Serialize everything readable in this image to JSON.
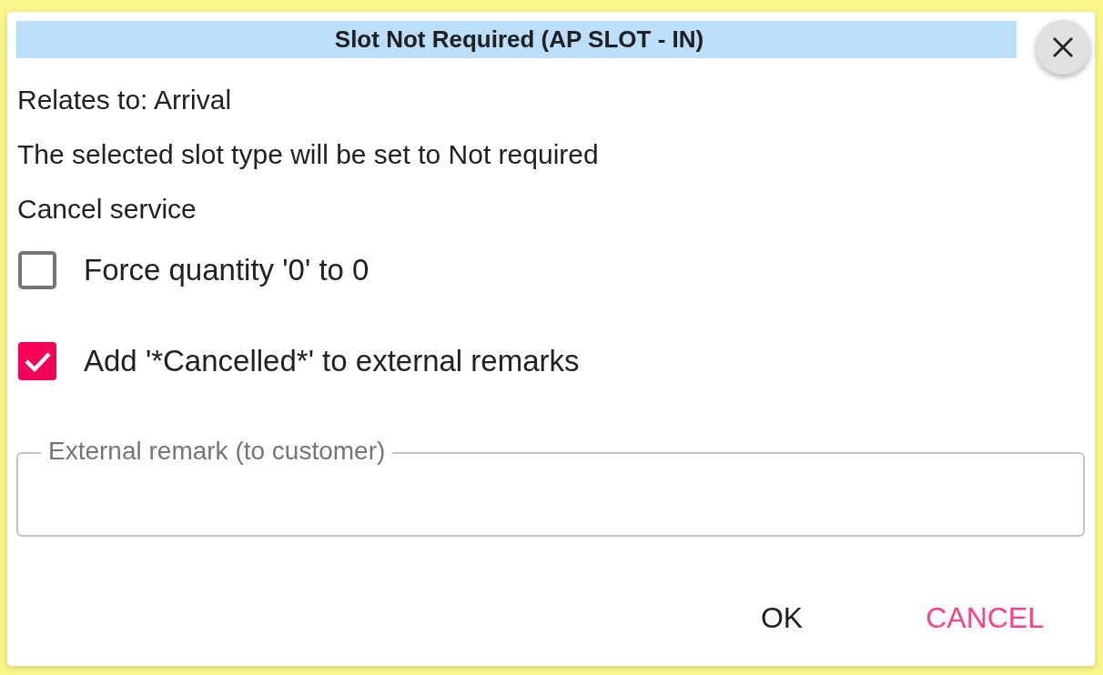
{
  "dialog": {
    "title": "Slot Not Required (AP SLOT - IN)",
    "lines": [
      "Relates to: Arrival",
      "The selected slot type will be set to Not required",
      "Cancel service"
    ],
    "options": [
      {
        "label": "Force quantity '0' to 0",
        "checked": false
      },
      {
        "label": "Add '*Cancelled*' to external remarks",
        "checked": true
      }
    ],
    "remark_field": {
      "label": "External remark (to customer)"
    },
    "buttons": [
      {
        "label": "OK",
        "kind": "plain"
      },
      {
        "label": "CANCEL",
        "kind": "accent"
      }
    ]
  }
}
